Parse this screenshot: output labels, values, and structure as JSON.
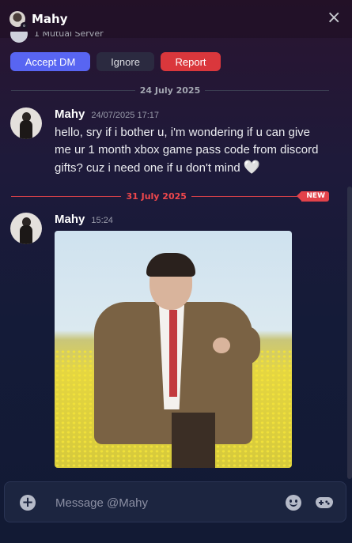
{
  "header": {
    "title": "Mahy",
    "close_icon": "close-icon"
  },
  "request": {
    "mutual_text": "1 Mutual Server",
    "accept_label": "Accept DM",
    "ignore_label": "Ignore",
    "report_label": "Report",
    "colors": {
      "accept": "#5865f2",
      "report": "#da373c"
    }
  },
  "dividers": {
    "first": "24 July 2025",
    "second": "31 July 2025",
    "new_badge": "NEW"
  },
  "messages": [
    {
      "author": "Mahy",
      "timestamp": "24/07/2025 17:17",
      "text": "hello, sry if i bother u, i'm wondering if u can give me ur 1 month xbox game pass code  from discord gifts?  cuz i need one if u don't mind",
      "emoji": "🤍"
    },
    {
      "author": "Mahy",
      "timestamp": "15:24",
      "attachment": "gif"
    }
  ],
  "composer": {
    "placeholder": "Message @Mahy",
    "icons": [
      "plus-circle-icon",
      "emoji-icon",
      "gamepad-icon"
    ]
  }
}
